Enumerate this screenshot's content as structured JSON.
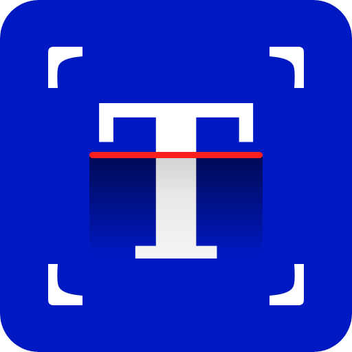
{
  "icon": {
    "glyph": "T",
    "name": "text-scanner-app-icon",
    "frame_icon": "scan-frame-corners-icon",
    "scan_line_icon": "scan-line-icon"
  },
  "colors": {
    "background": "#0019c2",
    "corners": "#ffffff",
    "glyph": "#ffffff",
    "scan_line": "#ff1f1f",
    "shadow_top": "#000a55",
    "shadow_bottom": "#0019c2"
  }
}
